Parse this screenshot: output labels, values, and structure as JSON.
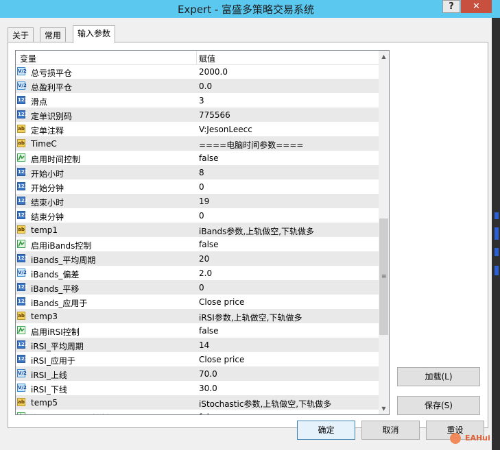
{
  "window": {
    "title": "Expert - 富盛多策略交易系统",
    "help_label": "?",
    "close_label": "✕"
  },
  "tabs": [
    {
      "label": "关于",
      "active": false
    },
    {
      "label": "常用",
      "active": false
    },
    {
      "label": "输入参数",
      "active": true
    }
  ],
  "grid": {
    "columns": {
      "variable": "变量",
      "value": "赋值"
    },
    "rows": [
      {
        "type": "double",
        "icon": "V/2",
        "name": "总亏损平仓",
        "value": "2000.0"
      },
      {
        "type": "double",
        "icon": "V/2",
        "name": "总盈利平仓",
        "value": "0.0"
      },
      {
        "type": "int",
        "icon": "123",
        "name": "滑点",
        "value": "3"
      },
      {
        "type": "int",
        "icon": "123",
        "name": "定单识别码",
        "value": "775566"
      },
      {
        "type": "string",
        "icon": "ab",
        "name": "定单注释",
        "value": "V:JesonLeecc"
      },
      {
        "type": "string",
        "icon": "ab",
        "name": "TimeC",
        "value": "====电脑时间参数===="
      },
      {
        "type": "bool",
        "icon": "",
        "name": "启用时间控制",
        "value": "false"
      },
      {
        "type": "int",
        "icon": "123",
        "name": "开始小时",
        "value": "8"
      },
      {
        "type": "int",
        "icon": "123",
        "name": "开始分钟",
        "value": "0"
      },
      {
        "type": "int",
        "icon": "123",
        "name": "结束小时",
        "value": "19"
      },
      {
        "type": "int",
        "icon": "123",
        "name": "结束分钟",
        "value": "0"
      },
      {
        "type": "string",
        "icon": "ab",
        "name": "temp1",
        "value": "iBands参数,上轨做空,下轨做多"
      },
      {
        "type": "bool",
        "icon": "",
        "name": "启用iBands控制",
        "value": "false"
      },
      {
        "type": "int",
        "icon": "123",
        "name": "iBands_平均周期",
        "value": "20"
      },
      {
        "type": "double",
        "icon": "V/2",
        "name": "iBands_偏差",
        "value": "2.0"
      },
      {
        "type": "int",
        "icon": "123",
        "name": "iBands_平移",
        "value": "0"
      },
      {
        "type": "int",
        "icon": "123",
        "name": "iBands_应用于",
        "value": "Close price"
      },
      {
        "type": "string",
        "icon": "ab",
        "name": "temp3",
        "value": "iRSI参数,上轨做空,下轨做多"
      },
      {
        "type": "bool",
        "icon": "",
        "name": "启用iRSI控制",
        "value": "false"
      },
      {
        "type": "int",
        "icon": "123",
        "name": "iRSI_平均周期",
        "value": "14"
      },
      {
        "type": "int",
        "icon": "123",
        "name": "iRSI_应用于",
        "value": "Close price"
      },
      {
        "type": "double",
        "icon": "V/2",
        "name": "iRSI_上线",
        "value": "70.0"
      },
      {
        "type": "double",
        "icon": "V/2",
        "name": "iRSI_下线",
        "value": "30.0"
      },
      {
        "type": "string",
        "icon": "ab",
        "name": "temp5",
        "value": "iStochastic参数,上轨做空,下轨做多"
      },
      {
        "type": "bool",
        "icon": "",
        "name": "启用iStochastic控制",
        "value": "fal"
      }
    ]
  },
  "side_buttons": {
    "load": "加载(L)",
    "save": "保存(S)"
  },
  "footer_buttons": {
    "ok": "确定",
    "cancel": "取消",
    "reset": "重设"
  },
  "watermark": "EAHui"
}
